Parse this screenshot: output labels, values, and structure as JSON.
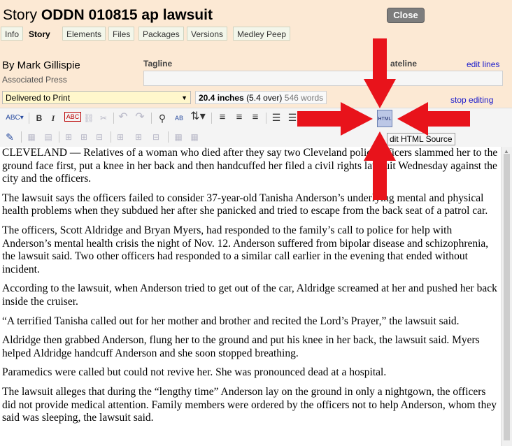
{
  "window": {
    "title_prefix": "Story",
    "title_slug": "ODDN 010815 ap lawsuit",
    "close_label": "Close"
  },
  "tabs": [
    "Info",
    "Story",
    "Elements",
    "Files",
    "Packages",
    "Versions",
    "Medley Peep"
  ],
  "active_tab": "Story",
  "byline": {
    "author": "By Mark Gillispie",
    "agency": "Associated Press"
  },
  "fields": {
    "tagline_label": "Tagline",
    "deadline_label_visible": "ateline",
    "edit_lines": "edit lines",
    "status": "Delivered to Print",
    "length_inches": "20.4 inches",
    "length_over": "(5.4 over)",
    "word_count": "546 words",
    "stop_editing": "stop editing"
  },
  "toolbar": {
    "html_button_label": "HTML",
    "tooltip": "Edit HTML Source",
    "tooltip_visible": "dit HTML Source",
    "bold": "B",
    "italic": "I",
    "spellcheck_label": "ABC",
    "find_replace_label": "AB"
  },
  "story_paragraphs": [
    "CLEVELAND — Relatives of a woman who died after they say two Cleveland police officers slammed her to the ground face first, put a knee in her back and then handcuffed her filed a civil rights lawsuit Wednesday against the city and the officers.",
    "The lawsuit says the officers failed to consider 37-year-old Tanisha Anderson’s underlying mental and physical health problems when they subdued her after she panicked and tried to escape from the back seat of a patrol car.",
    "The officers, Scott Aldridge and Bryan Myers, had responded to the family’s call to police for help with Anderson’s mental health crisis the night of Nov. 12. Anderson suffered from bipolar disease and schizophrenia, the lawsuit said. Two other officers had responded to a similar call earlier in the evening that ended without incident.",
    "According to the lawsuit, when Anderson tried to get out of the car, Aldridge screamed at her and pushed her back inside the cruiser.",
    "“A terrified Tanisha called out for her mother and brother and recited the Lord’s Prayer,” the lawsuit said.",
    "Aldridge then grabbed Anderson, flung her to the ground and put his knee in her back, the lawsuit said. Myers helped Aldridge handcuff Anderson and she soon stopped breathing.",
    "Paramedics were called but could not revive her. She was pronounced dead at a hospital.",
    "The lawsuit alleges that during the “lengthy time” Anderson lay on the ground in only a nightgown, the officers did not provide medical attention. Family members were ordered by the officers not to help Anderson, whom they said was sleeping, the lawsuit said."
  ],
  "colors": {
    "background": "#fce9d4",
    "arrow": "#e8131b",
    "link": "#1a1acc",
    "close_button": "#7d7d7d"
  },
  "annotation": {
    "arrows": [
      "down-arrow-icon",
      "up-arrow-icon",
      "right-arrow-icon",
      "left-arrow-icon"
    ]
  }
}
